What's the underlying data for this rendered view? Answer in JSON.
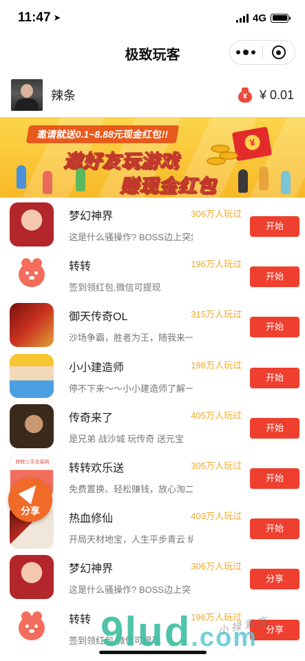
{
  "status_bar": {
    "time": "11:47",
    "network": "4G"
  },
  "nav": {
    "title": "极致玩客"
  },
  "user": {
    "name": "辣条",
    "balance": "¥ 0.01",
    "bag_symbol": "¥"
  },
  "banner": {
    "tagline": "邀请就送0.1~8.88元现金红包!!",
    "line1": "邀好友玩游戏",
    "line2": "赚现金红包",
    "envelope_symbol": "¥"
  },
  "games": [
    {
      "name": "梦幻神界",
      "plays": "306万人玩过",
      "desc": "这是什么骚操作? BOSS边上突然",
      "button": "开始",
      "icon": "dream-realm-icon"
    },
    {
      "name": "转转",
      "plays": "196万人玩过",
      "desc": "签到领红包,微信可提现",
      "button": "开始",
      "icon": "zhuanzhuan-bear-icon"
    },
    {
      "name": "御天传奇OL",
      "plays": "315万人玩过",
      "desc": "沙场争霸，胜者为王，随我来一",
      "button": "开始",
      "icon": "legend-ol-icon"
    },
    {
      "name": "小小建造师",
      "plays": "198万人玩过",
      "desc": "停不下来～～小小建造师了解一",
      "button": "开始",
      "icon": "builder-icon"
    },
    {
      "name": "传奇来了",
      "plays": "405万人玩过",
      "desc": "是兄弟 战沙城 玩传奇 送元宝",
      "button": "开始",
      "icon": "legend-comes-icon"
    },
    {
      "name": "转转欢乐送",
      "plays": "305万人玩过",
      "desc": "免费置换、轻松赚钱，放心淘二",
      "button": "开始",
      "icon": "secondhand-icon",
      "icon_text": "转转二手交易网"
    },
    {
      "name": "热血修仙",
      "plays": "403万人玩过",
      "desc": "开局天材地宝，人生平步青云 纵",
      "button": "开始",
      "icon": "cultivation-icon"
    },
    {
      "name": "梦幻神界",
      "plays": "306万人玩过",
      "desc": "这是什么骚操作? BOSS边上突",
      "button": "分享",
      "icon": "dream-realm-icon"
    },
    {
      "name": "转转",
      "plays": "196万人玩过",
      "desc": "签到领红包,微信可提现",
      "button": "分享",
      "icon": "zhuanzhuan-bear-icon"
    }
  ],
  "float_share": {
    "label": "分享"
  },
  "watermark": {
    "text": "9lud",
    "suffix": ".com",
    "signature": "小 禄 素 充"
  }
}
